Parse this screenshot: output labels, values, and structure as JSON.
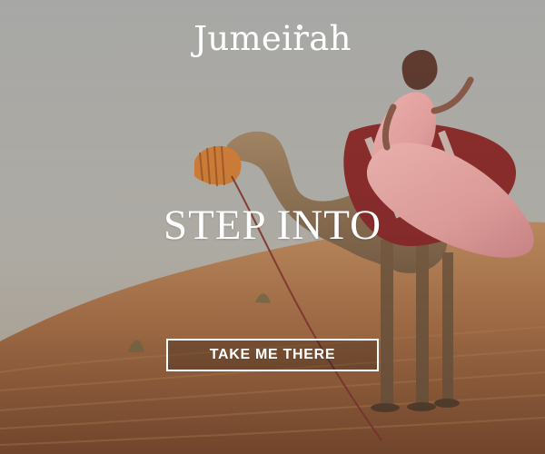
{
  "brand": {
    "logo_text": "Jumeirah",
    "text_color": "#ffffff"
  },
  "hero": {
    "headline": "STEP INTO"
  },
  "cta": {
    "label": "TAKE ME THERE",
    "border_color": "#ffffff"
  },
  "scene": {
    "sky_color": "#b8b5ad",
    "sand_color": "#b77f53",
    "dress_color": "#e6a2a0"
  }
}
